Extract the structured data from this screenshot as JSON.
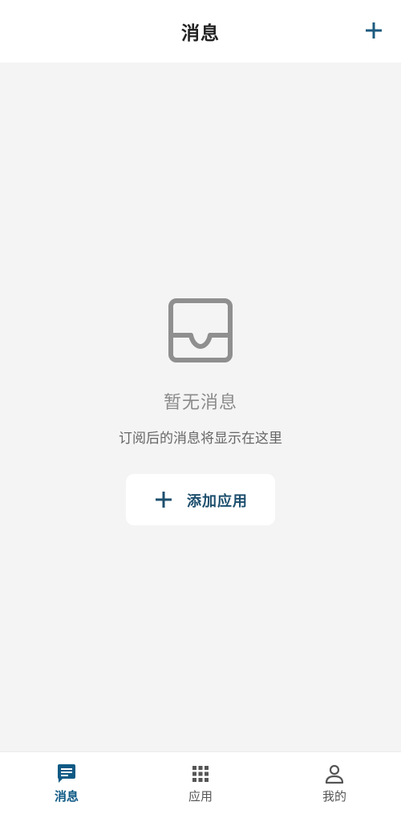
{
  "header": {
    "title": "消息",
    "add_icon": "plus-icon"
  },
  "empty_state": {
    "icon": "inbox-tray-icon",
    "title": "暂无消息",
    "description": "订阅后的消息将显示在这里",
    "action": {
      "icon": "plus-icon",
      "label": "添加应用"
    }
  },
  "tabbar": {
    "tabs": [
      {
        "label": "消息",
        "icon": "message-icon",
        "active": true
      },
      {
        "label": "应用",
        "icon": "grid-icon",
        "active": false
      },
      {
        "label": "我的",
        "icon": "person-icon",
        "active": false
      }
    ]
  },
  "colors": {
    "accent": "#0f5a85",
    "accent_dark": "#1d4f6e",
    "background": "#f4f4f5",
    "empty_icon": "#8f8f8f",
    "inactive_tab": "#555555"
  }
}
